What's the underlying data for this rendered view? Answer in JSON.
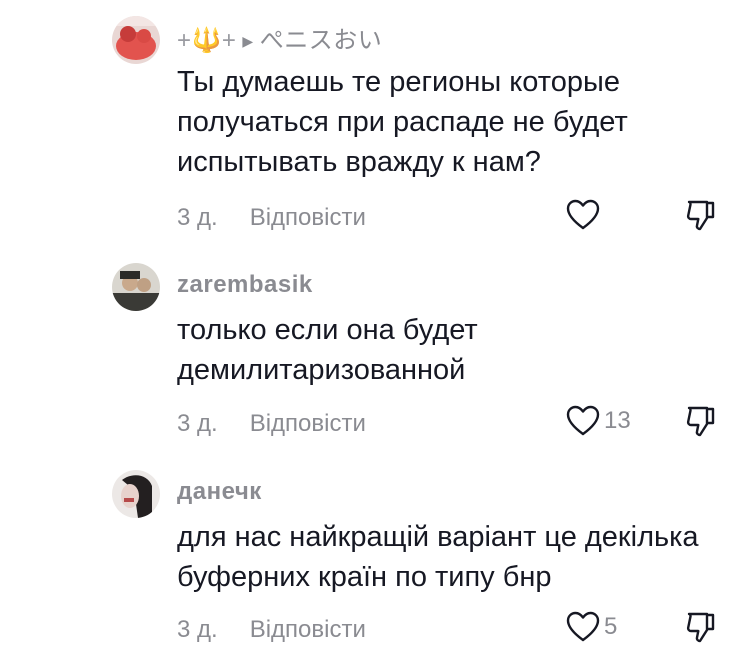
{
  "comments": [
    {
      "username": "+🔱+",
      "reply_to": "ぺニスおい",
      "text": "Ты думаешь те регионы которые получаться при распаде не будет испытывать вражду к нам?",
      "time": "3 д.",
      "reply_label": "Відповісти",
      "likes": ""
    },
    {
      "username": "zarembasik",
      "text": "только если она будет демилитаризованной",
      "time": "3 д.",
      "reply_label": "Відповісти",
      "likes": "13"
    },
    {
      "username": "данечк",
      "text": "для нас найкращій варіант це декілька буферних країн по типу бнр",
      "time": "3 д.",
      "reply_label": "Відповісти",
      "likes": "5"
    }
  ],
  "icons": {
    "like": "heart-outline-icon",
    "dislike": "thumbs-down-outline-icon",
    "reply_arrow": "caret-right-icon"
  },
  "colors": {
    "text": "#161823",
    "muted": "#8a8b91"
  }
}
